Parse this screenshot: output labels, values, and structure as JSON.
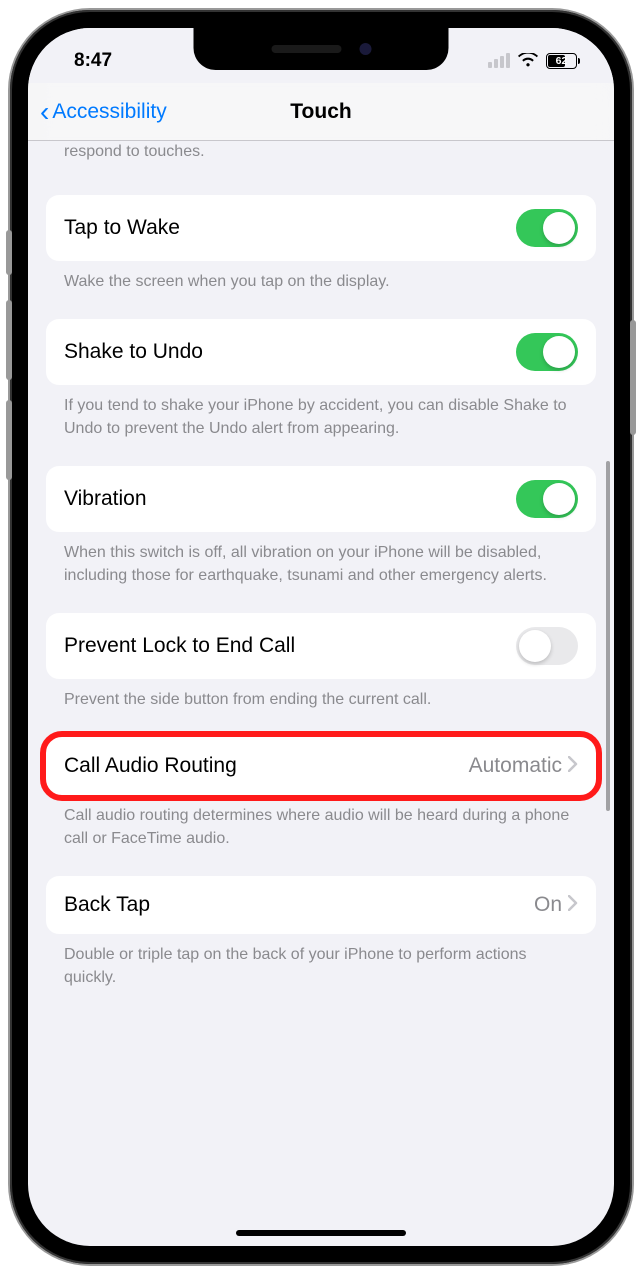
{
  "status": {
    "time": "8:47",
    "battery_percent": "62"
  },
  "nav": {
    "back_label": "Accessibility",
    "title": "Touch"
  },
  "cut_text": "respond to touches.",
  "rows": {
    "tap_to_wake": {
      "label": "Tap to Wake",
      "enabled": true,
      "footer": "Wake the screen when you tap on the display."
    },
    "shake_to_undo": {
      "label": "Shake to Undo",
      "enabled": true,
      "footer": "If you tend to shake your iPhone by accident, you can disable Shake to Undo to prevent the Undo alert from appearing."
    },
    "vibration": {
      "label": "Vibration",
      "enabled": true,
      "footer": "When this switch is off, all vibration on your iPhone will be disabled, including those for earthquake, tsunami and other emergency alerts."
    },
    "prevent_lock": {
      "label": "Prevent Lock to End Call",
      "enabled": false,
      "footer": "Prevent the side button from ending the current call."
    },
    "call_audio": {
      "label": "Call Audio Routing",
      "value": "Automatic",
      "footer": "Call audio routing determines where audio will be heard during a phone call or FaceTime audio."
    },
    "back_tap": {
      "label": "Back Tap",
      "value": "On",
      "footer": "Double or triple tap on the back of your iPhone to perform actions quickly."
    }
  }
}
